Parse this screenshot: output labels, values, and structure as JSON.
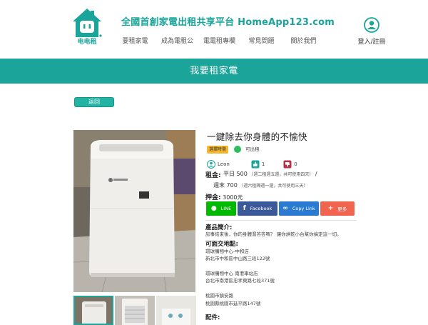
{
  "header": {
    "logo_text": "电电租",
    "site_title": "全國首創家電出租共享平台  HomeApp123.com",
    "nav": [
      "要租家電",
      "成為電租公",
      "電電租專欄",
      "常見問題",
      "關於我們"
    ],
    "user_label": "登入/註冊"
  },
  "banner": {
    "title": "我要租家電"
  },
  "back_button": "返回",
  "product": {
    "title": "一鍵除去你身體的不愉快",
    "badge": "選擇時需",
    "status": "可出租",
    "owner": "Leon",
    "likes": "1",
    "dislikes": "0",
    "rent_label": "租金:",
    "rent_weekday_main": "平日 500",
    "rent_weekday_note": "（週二租週五還，共可使用四天）",
    "rent_weekday_suffix": "/",
    "rent_weekend_main": "週末 700",
    "rent_weekend_note": "（週六租隔週一還，共可使用三天）",
    "deposit_label": "押金:",
    "deposit_value": "3000元"
  },
  "share": {
    "line": "LINE",
    "facebook": "Facebook",
    "copy": "Copy Link",
    "more": "更多"
  },
  "sections": {
    "intro_title": "產品簡介:",
    "intro_text": "房事結束後，你的身體濕答答嗎？ 讓你烘乾小台幫你搞定這一切。",
    "pickup_title": "可面交地點:",
    "pickup": [
      {
        "name": "環球購物中心-中和店",
        "addr": "新北市中和區中山路三段122號"
      },
      {
        "name": "環球購物中心 南港車站店",
        "addr": "台北市南港區忠孝東路七段371號"
      },
      {
        "name": "桃園市鎮安路",
        "addr": "桃園縣桃園市延平路147號"
      }
    ],
    "parts_title": "配件:"
  },
  "colors": {
    "brand": "#1aa49a",
    "line": "#00b900",
    "facebook": "#3b5998",
    "copy": "#2a7ad1",
    "more": "#f06450",
    "hot_badge": "#f5b72e",
    "status_ok": "#2dbd5e"
  },
  "icons": {
    "logo": "house-plug-icon",
    "user": "user-circle-icon",
    "owner": "user-icon",
    "like": "thumbs-up-icon",
    "dislike": "thumbs-down-icon",
    "line": "line-icon",
    "facebook": "facebook-icon",
    "copy": "link-icon",
    "more": "plus-icon"
  }
}
